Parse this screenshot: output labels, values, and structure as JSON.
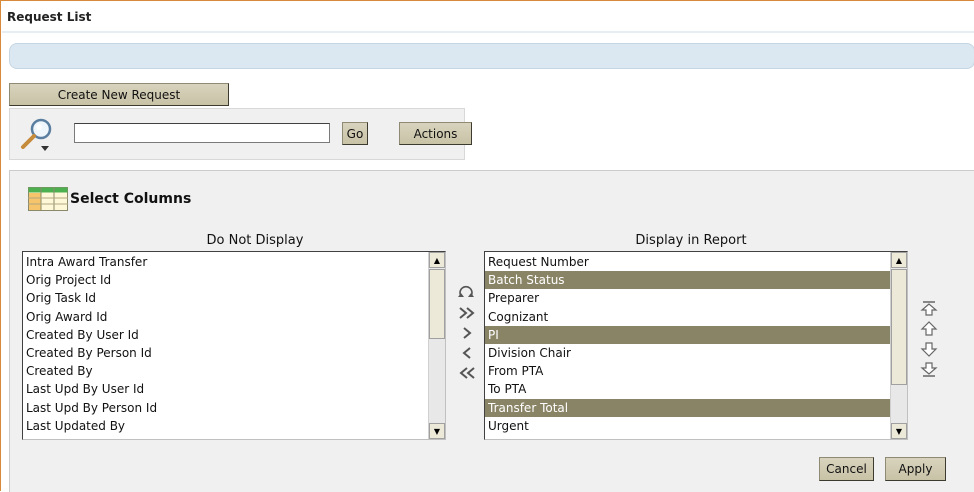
{
  "page": {
    "title": "Request List"
  },
  "toolbar": {
    "create_label": "Create New Request",
    "search_value": "",
    "go_label": "Go",
    "actions_label": "Actions"
  },
  "columns": {
    "title": "Select Columns",
    "left_header": "Do Not Display",
    "right_header": "Display in Report",
    "not_displayed": [
      {
        "label": "Intra Award Transfer",
        "selected": false
      },
      {
        "label": "Orig Project Id",
        "selected": false
      },
      {
        "label": "Orig Task Id",
        "selected": false
      },
      {
        "label": "Orig Award Id",
        "selected": false
      },
      {
        "label": "Created By User Id",
        "selected": false
      },
      {
        "label": "Created By Person Id",
        "selected": false
      },
      {
        "label": "Created By",
        "selected": false
      },
      {
        "label": "Last Upd By User Id",
        "selected": false
      },
      {
        "label": "Last Upd By Person Id",
        "selected": false
      },
      {
        "label": "Last Updated By",
        "selected": false
      }
    ],
    "displayed": [
      {
        "label": "Request Number",
        "selected": false
      },
      {
        "label": "Batch Status",
        "selected": true
      },
      {
        "label": "Preparer",
        "selected": false
      },
      {
        "label": "Cognizant",
        "selected": false
      },
      {
        "label": "PI",
        "selected": true
      },
      {
        "label": "Division Chair",
        "selected": false
      },
      {
        "label": "From PTA",
        "selected": false
      },
      {
        "label": "To PTA",
        "selected": false
      },
      {
        "label": "Transfer Total",
        "selected": true
      },
      {
        "label": "Urgent",
        "selected": false
      }
    ],
    "cancel_label": "Cancel",
    "apply_label": "Apply"
  },
  "colors": {
    "selection": "#8a8466",
    "button_face": "#d8d3bd",
    "info_bar": "#dbe7f1",
    "accent_border": "#d88a3a"
  }
}
